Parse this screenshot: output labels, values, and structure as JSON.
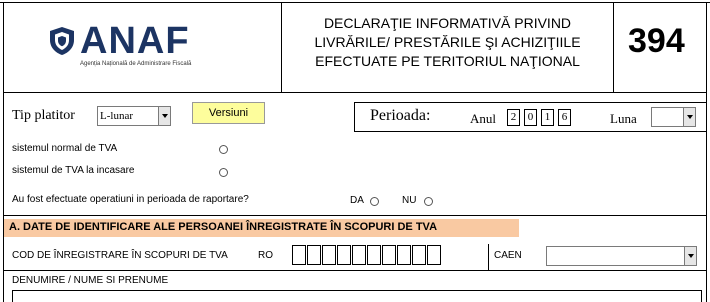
{
  "header": {
    "logo": {
      "name": "ANAF",
      "subtitle": "Agenția Națională de Administrare Fiscală"
    },
    "title_lines": [
      "DECLARAŢIE INFORMATIVĂ PRIVIND",
      "LIVRĂRILE/ PRESTĂRILE ŞI ACHIZIŢIILE",
      "EFECTUATE PE TERITORIUL NAŢIONAL"
    ],
    "form_number": "394"
  },
  "row1": {
    "tip_platitor_label": "Tip platitor",
    "tip_platitor_value": "L-lunar",
    "versiuni_label": "Versiuni",
    "perioada_label": "Perioada:",
    "anul_label": "Anul",
    "year_digits": [
      "2",
      "0",
      "1",
      "6"
    ],
    "luna_label": "Luna",
    "luna_value": ""
  },
  "options": {
    "normal_label": "sistemul normal de TVA",
    "incasare_label": "sistemul de TVA la incasare",
    "operatiuni_question": "Au fost efectuate operatiuni in perioada de raportare?",
    "da_label": "DA",
    "nu_label": "NU"
  },
  "section_a": {
    "title": "A. DATE DE IDENTIFICARE ALE PERSOANEI ÎNREGISTRATE ÎN SCOPURI DE TVA",
    "cod_label": "COD DE ÎNREGISTRARE ÎN SCOPURI DE TVA",
    "ro_label": "RO",
    "caen_label": "CAEN",
    "caen_value": "",
    "denumire_label": "DENUMIRE / NUME SI PRENUME"
  },
  "colors": {
    "accent": "#1c3463",
    "section_bg": "#f9c9a2",
    "button_bg": "#fdfd9c"
  }
}
